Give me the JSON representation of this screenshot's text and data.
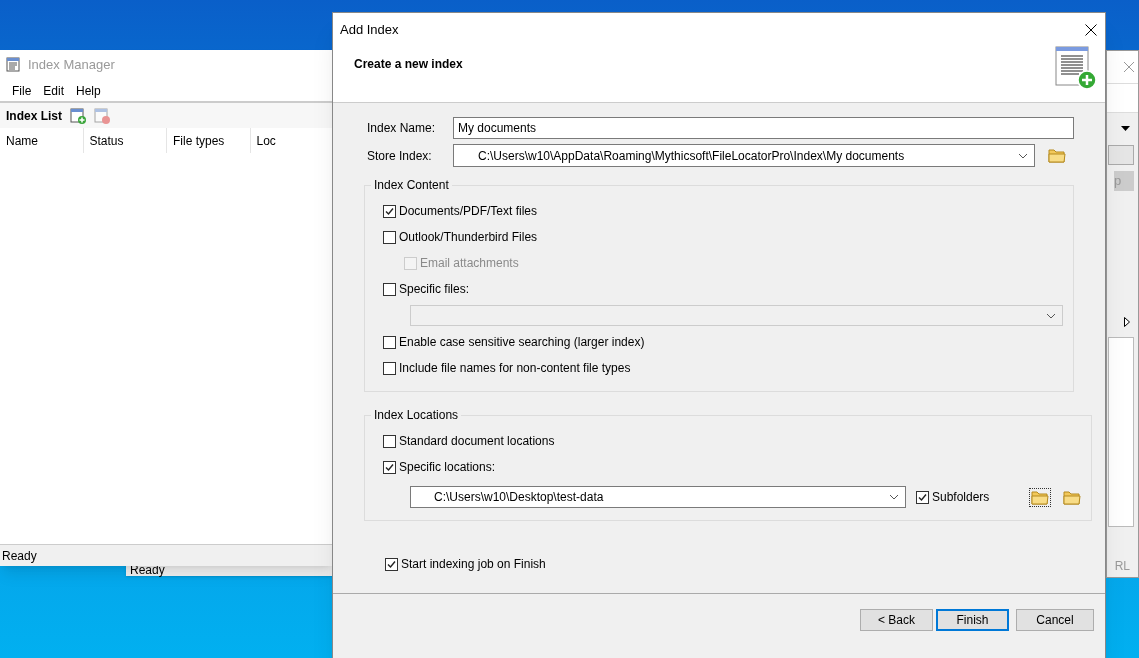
{
  "index_manager": {
    "title": "Index Manager",
    "menu": [
      "File",
      "Edit",
      "Help"
    ],
    "toolbar_label": "Index List",
    "columns": [
      "Name",
      "Status",
      "File types",
      "Loc"
    ],
    "status": "Ready"
  },
  "background_window": {
    "status": "Ready"
  },
  "right_window": {
    "button_text": "p",
    "status_text": "RL"
  },
  "dialog": {
    "title": "Add Index",
    "heading": "Create a new index",
    "index_name": {
      "label": "Index Name:",
      "value": "My documents"
    },
    "store_index": {
      "label": "Store Index:",
      "value": "C:\\Users\\w10\\AppData\\Roaming\\Mythicsoft\\FileLocatorPro\\Index\\My documents"
    },
    "content_group": {
      "title": "Index Content",
      "options": [
        {
          "kind": "checkbox",
          "label": "Documents/PDF/Text files",
          "checked": true,
          "disabled": false
        },
        {
          "kind": "checkbox",
          "label": "Outlook/Thunderbird Files",
          "checked": false,
          "disabled": false,
          "children": [
            {
              "kind": "checkbox",
              "label": "Email attachments",
              "checked": false,
              "disabled": true
            }
          ]
        },
        {
          "kind": "checkbox",
          "label": "Specific files:",
          "checked": false,
          "disabled": false
        },
        {
          "kind": "combo",
          "disabled": true
        },
        {
          "kind": "checkbox",
          "label": "Enable case sensitive searching (larger index)",
          "checked": false,
          "disabled": false
        },
        {
          "kind": "checkbox",
          "label": "Include file names for non-content file types",
          "checked": false,
          "disabled": false
        }
      ]
    },
    "locations_group": {
      "title": "Index Locations",
      "options": [
        {
          "kind": "checkbox",
          "label": "Standard document locations",
          "checked": false,
          "disabled": false
        },
        {
          "kind": "checkbox",
          "label": "Specific locations:",
          "checked": true,
          "disabled": false
        }
      ],
      "location": {
        "value": "C:\\Users\\w10\\Desktop\\test-data",
        "subfolders": {
          "label": "Subfolders",
          "checked": true
        }
      }
    },
    "start_on_finish": {
      "label": "Start indexing job on Finish",
      "checked": true
    },
    "buttons": [
      {
        "label": "< Back",
        "focused": false
      },
      {
        "label": "Finish",
        "focused": true
      },
      {
        "label": "Cancel",
        "focused": false
      }
    ]
  }
}
